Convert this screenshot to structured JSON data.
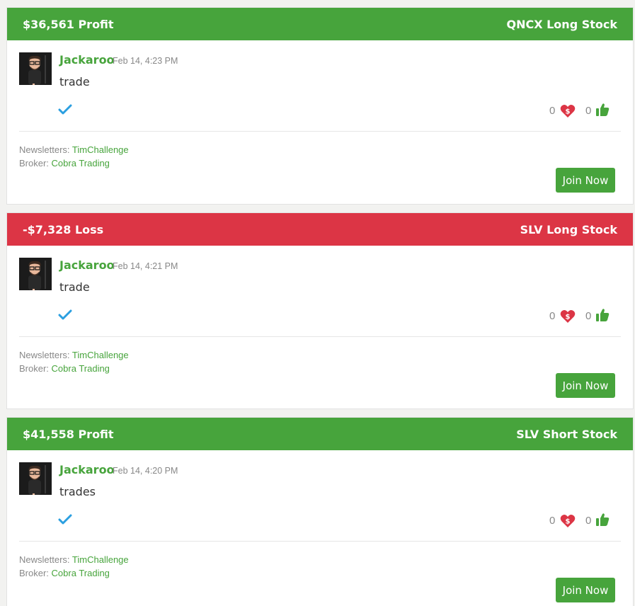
{
  "colors": {
    "profit": "#47a43c",
    "loss": "#dc3545",
    "link": "#47a43c",
    "check": "#2b9fe0"
  },
  "labels": {
    "newsletters": "Newsletters:",
    "broker": "Broker:",
    "join": "Join Now"
  },
  "trades": [
    {
      "result": "$36,561 Profit",
      "result_type": "profit",
      "instrument": "QNCX Long Stock",
      "author": "Jackaroo",
      "timestamp": "Feb 14, 4:23 PM",
      "text": "trade",
      "likes": "0",
      "thumbs": "0",
      "newsletter": "TimChallenge",
      "broker": "Cobra Trading",
      "icons": {
        "avatar": "user-avatar",
        "check": "check-icon",
        "heart": "heart-dollar-icon",
        "thumbs": "thumbs-up-icon"
      }
    },
    {
      "result": "-$7,328 Loss",
      "result_type": "loss",
      "instrument": "SLV Long Stock",
      "author": "Jackaroo",
      "timestamp": "Feb 14, 4:21 PM",
      "text": "trade",
      "likes": "0",
      "thumbs": "0",
      "newsletter": "TimChallenge",
      "broker": "Cobra Trading",
      "icons": {
        "avatar": "user-avatar",
        "check": "check-icon",
        "heart": "heart-dollar-icon",
        "thumbs": "thumbs-up-icon"
      }
    },
    {
      "result": "$41,558 Profit",
      "result_type": "profit",
      "instrument": "SLV Short Stock",
      "author": "Jackaroo",
      "timestamp": "Feb 14, 4:20 PM",
      "text": "trades",
      "likes": "0",
      "thumbs": "0",
      "newsletter": "TimChallenge",
      "broker": "Cobra Trading",
      "icons": {
        "avatar": "user-avatar",
        "check": "check-icon",
        "heart": "heart-dollar-icon",
        "thumbs": "thumbs-up-icon"
      }
    }
  ]
}
